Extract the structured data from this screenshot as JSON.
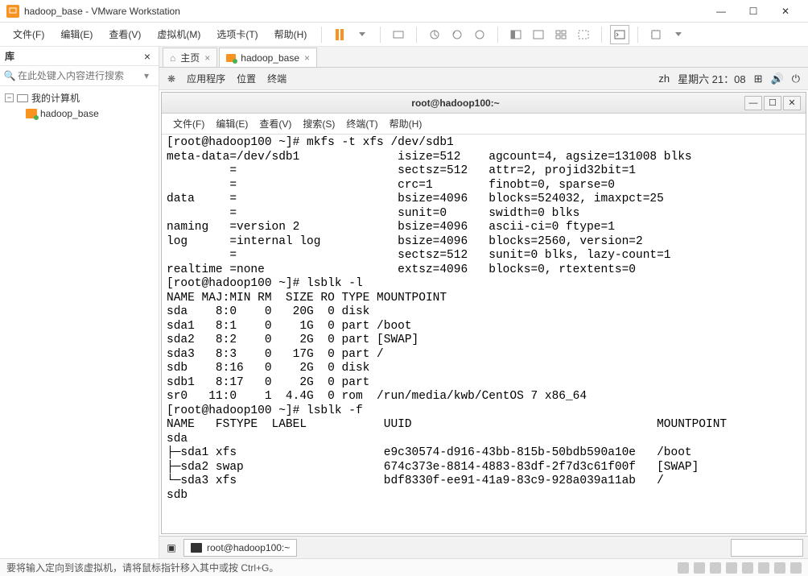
{
  "window": {
    "title": "hadoop_base - VMware Workstation"
  },
  "menu": {
    "file": "文件(F)",
    "edit": "编辑(E)",
    "view": "查看(V)",
    "vm": "虚拟机(M)",
    "tabs": "选项卡(T)",
    "help": "帮助(H)"
  },
  "sidebar": {
    "title": "库",
    "search_placeholder": "在此处键入内容进行搜索",
    "root": "我的计算机",
    "vm_name": "hadoop_base"
  },
  "tabs": {
    "home": "主页",
    "vm": "hadoop_base"
  },
  "gnome": {
    "apps_icon": "❋",
    "apps": "应用程序",
    "places": "位置",
    "terminal": "终端",
    "lang": "zh",
    "clock": "星期六 21：08"
  },
  "terminal_window": {
    "title": "root@hadoop100:~",
    "menu": {
      "file": "文件(F)",
      "edit": "编辑(E)",
      "view": "查看(V)",
      "search": "搜索(S)",
      "terminal": "终端(T)",
      "help": "帮助(H)"
    }
  },
  "terminal_output": "[root@hadoop100 ~]# mkfs -t xfs /dev/sdb1\nmeta-data=/dev/sdb1              isize=512    agcount=4, agsize=131008 blks\n         =                       sectsz=512   attr=2, projid32bit=1\n         =                       crc=1        finobt=0, sparse=0\ndata     =                       bsize=4096   blocks=524032, imaxpct=25\n         =                       sunit=0      swidth=0 blks\nnaming   =version 2              bsize=4096   ascii-ci=0 ftype=1\nlog      =internal log           bsize=4096   blocks=2560, version=2\n         =                       sectsz=512   sunit=0 blks, lazy-count=1\nrealtime =none                   extsz=4096   blocks=0, rtextents=0\n[root@hadoop100 ~]# lsblk -l\nNAME MAJ:MIN RM  SIZE RO TYPE MOUNTPOINT\nsda    8:0    0   20G  0 disk \nsda1   8:1    0    1G  0 part /boot\nsda2   8:2    0    2G  0 part [SWAP]\nsda3   8:3    0   17G  0 part /\nsdb    8:16   0    2G  0 disk \nsdb1   8:17   0    2G  0 part \nsr0   11:0    1  4.4G  0 rom  /run/media/kwb/CentOS 7 x86_64\n[root@hadoop100 ~]# lsblk -f\nNAME   FSTYPE  LABEL           UUID                                   MOUNTPOINT\nsda                                                                    \n├─sda1 xfs                     e9c30574-d916-43bb-815b-50bdb590a10e   /boot\n├─sda2 swap                    674c373e-8814-4883-83df-2f7d3c61f00f   [SWAP]\n└─sda3 xfs                     bdf8330f-ee91-41a9-83c9-928a039a11ab   /\nsdb                                                                    ",
  "taskbar": {
    "task1": "root@hadoop100:~"
  },
  "status": {
    "message": "要将输入定向到该虚拟机，请将鼠标指针移入其中或按 Ctrl+G。"
  }
}
